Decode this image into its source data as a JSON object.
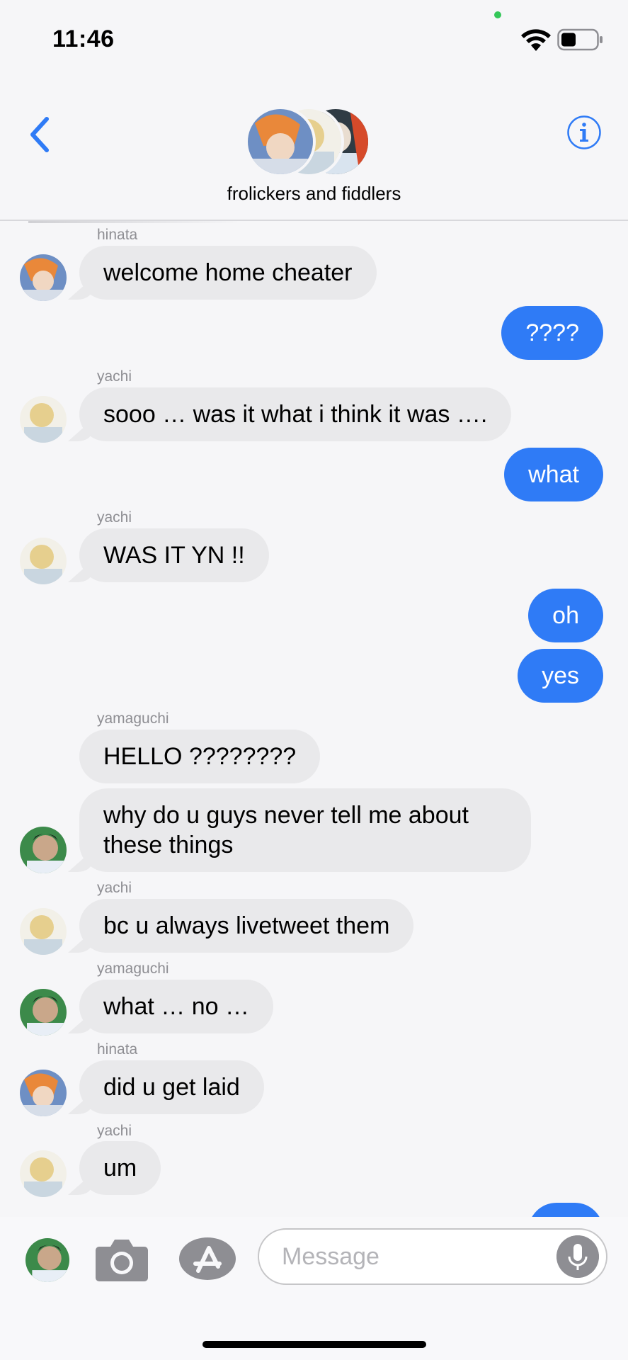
{
  "status": {
    "time": "11:46"
  },
  "header": {
    "group_name": "frolickers and fiddlers"
  },
  "messages": [
    {
      "sender": "hinata",
      "text": "welcome home cheater"
    },
    {
      "text": "????"
    },
    {
      "sender": "yachi",
      "text": "sooo … was it what i think it was …."
    },
    {
      "text": "what"
    },
    {
      "sender": "yachi",
      "text": "WAS IT YN !!"
    },
    {
      "text": "oh"
    },
    {
      "text": "yes"
    },
    {
      "sender": "yamaguchi",
      "text": "HELLO ????????"
    },
    {
      "text": "why do u guys never tell me about these things"
    },
    {
      "sender": "yachi",
      "text": "bc u always livetweet them"
    },
    {
      "sender": "yamaguchi",
      "text": "what … no …"
    },
    {
      "sender": "hinata",
      "text": "did u get laid"
    },
    {
      "sender": "yachi",
      "text": "um"
    }
  ],
  "input": {
    "placeholder": "Message"
  },
  "colors": {
    "accent": "#2f7bf6",
    "incoming": "#e9e9eb",
    "background": "#f6f6f8"
  },
  "icons": [
    "back-chevron-icon",
    "info-icon",
    "camera-icon",
    "app-store-icon",
    "microphone-icon",
    "wifi-icon",
    "battery-icon"
  ]
}
